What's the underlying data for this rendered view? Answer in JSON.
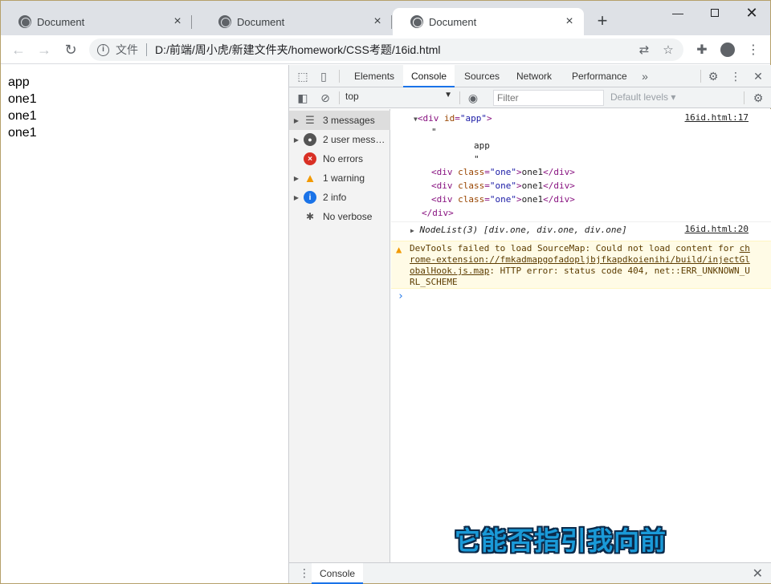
{
  "browser": {
    "tabs": [
      {
        "title": "Document",
        "active": false
      },
      {
        "title": "Document",
        "active": false
      },
      {
        "title": "Document",
        "active": true
      }
    ],
    "address": {
      "scheme_label": "文件",
      "url": "D:/前端/周小虎/新建文件夹/homework/CSS考题/16id.html"
    }
  },
  "page": {
    "lines": [
      "app",
      "one1",
      "one1",
      "one1"
    ]
  },
  "devtools": {
    "tabs": [
      "Elements",
      "Console",
      "Sources",
      "Network",
      "Performance"
    ],
    "active_tab": "Console",
    "context": "top",
    "filter_placeholder": "Filter",
    "levels_label": "Default levels ▾",
    "sidebar": [
      {
        "label": "3 messages",
        "icon": "list-icon"
      },
      {
        "label": "2 user mess…",
        "icon": "user-icon"
      },
      {
        "label": "No errors",
        "icon": "error-icon"
      },
      {
        "label": "1 warning",
        "icon": "warning-icon"
      },
      {
        "label": "2 info",
        "icon": "info-icon"
      },
      {
        "label": "No verbose",
        "icon": "bug-icon"
      }
    ],
    "console": {
      "log1": {
        "source": "16id.html:17",
        "div_open_tag": "div",
        "div_attr": "id",
        "div_val": "\"app\"",
        "text_quote": "\"",
        "text_app": "app",
        "children": [
          {
            "tag": "div",
            "attr": "class",
            "val": "\"one\"",
            "text": "one1"
          },
          {
            "tag": "div",
            "attr": "class",
            "val": "\"one\"",
            "text": "one1"
          },
          {
            "tag": "div",
            "attr": "class",
            "val": "\"one\"",
            "text": "one1"
          }
        ],
        "div_close": "</div>"
      },
      "log2": {
        "source": "16id.html:20",
        "text": "NodeList(3) [div.one, div.one, div.one]"
      },
      "warning": {
        "prefix": "DevTools failed to load SourceMap: Could not load content for ",
        "link": "chrome-extension://fmkadmapgofadopljbjfkapdkoienihi/build/injectGlobalHook.js.map",
        "suffix": ": HTTP error: status code 404, net::ERR_UNKNOWN_URL_SCHEME"
      }
    },
    "drawer_tab": "Console"
  },
  "overlay_caption": "它能否指引我向前"
}
